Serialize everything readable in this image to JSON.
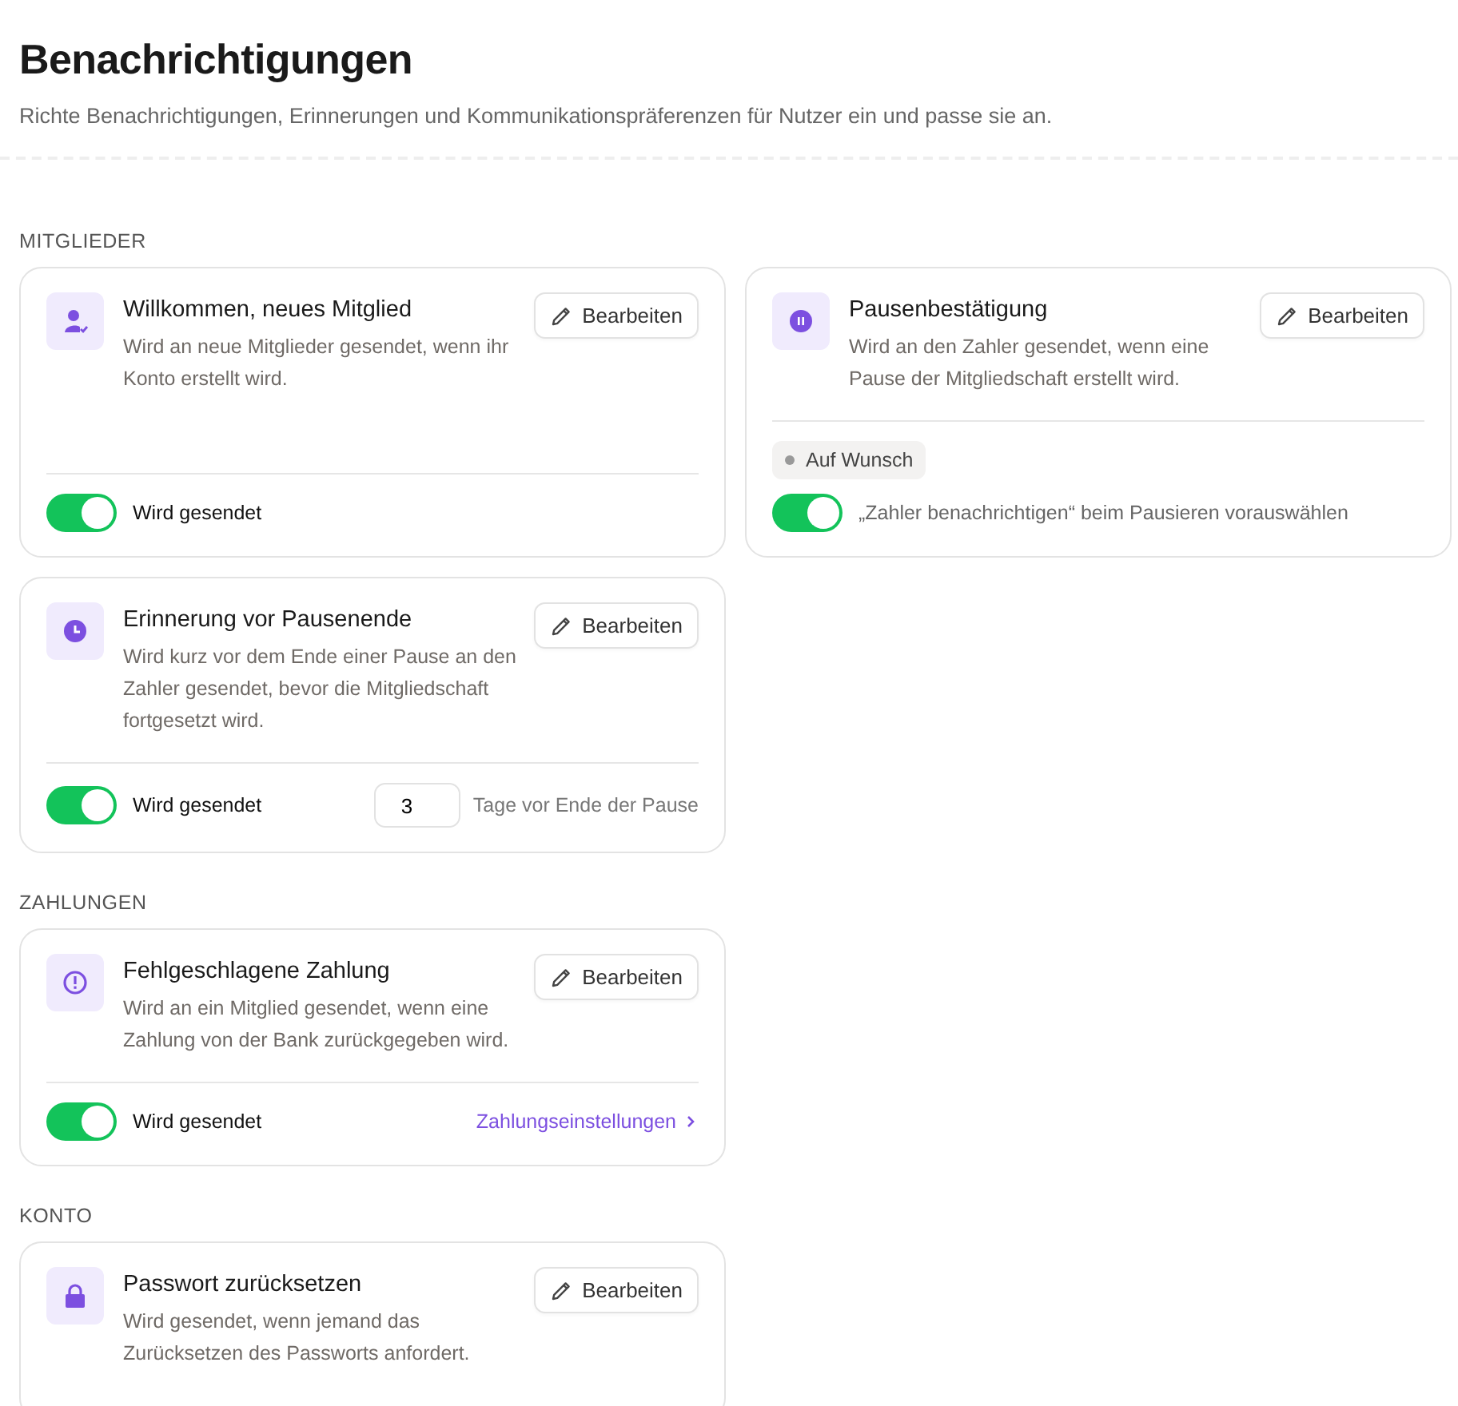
{
  "page": {
    "title": "Benachrichtigungen",
    "subtitle": "Richte Benachrichtigungen, Erinnerungen und Kommunikationspräferenzen für Nutzer ein und passe sie an."
  },
  "sections": [
    {
      "title": "MITGLIEDER",
      "cards": [
        {
          "title": "Willkommen, neues Mitglied",
          "description": "Wird an neue Mitglieder gesendet, wenn ihr Konto erstellt wird.",
          "edit": "Bearbeiten",
          "footer": {
            "kind": "status",
            "toggle": {
              "on": true,
              "label": "Wird gesendet"
            }
          }
        },
        {
          "title": "Pausenbestätigung",
          "description": "Wird an den Zahler gesendet, wenn eine Pause der Mitgliedschaft erstellt wird.",
          "edit": "Bearbeiten",
          "footer": {
            "kind": "option",
            "badge": "Auf Wunsch",
            "toggle": {
              "on": true,
              "label": "„Zahler benachrichtigen“ beim Pausieren vorauswählen"
            }
          }
        },
        {
          "title": "Erinnerung vor Pausenende",
          "description": "Wird kurz vor dem Ende einer Pause an den Zahler gesendet, bevor die Mitgliedschaft fortgesetzt wird.",
          "edit": "Bearbeiten",
          "footer": {
            "kind": "status",
            "toggle": {
              "on": true,
              "label": "Wird gesendet"
            },
            "input": {
              "value": "3",
              "suffix": "Tage vor Ende der Pause"
            }
          }
        }
      ]
    },
    {
      "title": "ZAHLUNGEN",
      "cards": [
        {
          "title": "Fehlgeschlagene Zahlung",
          "description": "Wird an ein Mitglied gesendet, wenn eine Zahlung von der Bank zurückgegeben wird.",
          "edit": "Bearbeiten",
          "footer": {
            "kind": "status",
            "toggle": {
              "on": true,
              "label": "Wird gesendet"
            },
            "link": "Zahlungseinstellungen"
          }
        }
      ]
    },
    {
      "title": "KONTO",
      "cards": [
        {
          "title": "Passwort zurücksetzen",
          "description": "Wird gesendet, wenn jemand das Zurücksetzen des Passworts anfordert.",
          "edit": "Bearbeiten"
        }
      ]
    }
  ]
}
